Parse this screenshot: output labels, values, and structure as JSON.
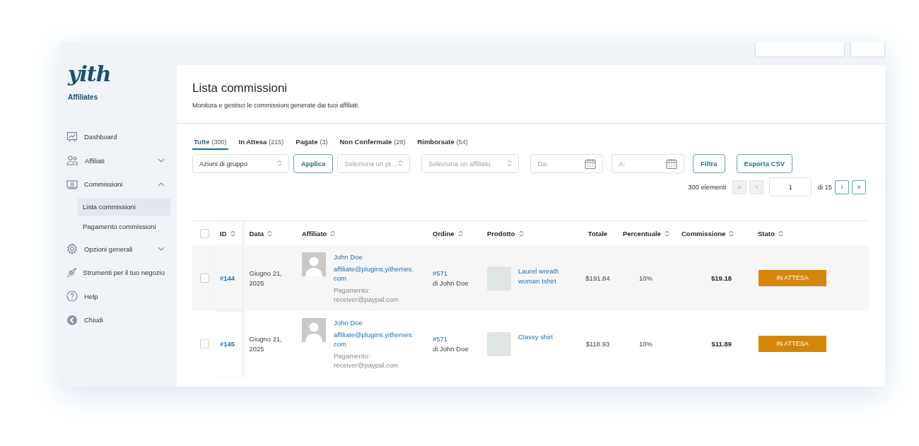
{
  "sidebar": {
    "logo": "yith",
    "product": "Affiliates",
    "items": [
      {
        "label": "Dashboard"
      },
      {
        "label": "Affiliati",
        "expanded": false
      },
      {
        "label": "Commissioni",
        "expanded": true,
        "children": [
          {
            "label": "Lista commissioni",
            "selected": true
          },
          {
            "label": "Pagamento commissioni",
            "selected": false
          }
        ]
      },
      {
        "label": "Opzioni generali",
        "expanded": false
      },
      {
        "label": "Strumenti per il tuo negozio"
      },
      {
        "label": "Help"
      },
      {
        "label": "Chiudi"
      }
    ]
  },
  "header": {
    "title": "Lista commissioni",
    "description": "Monitora e gestisci le commissioni generate dai tuoi affiliati."
  },
  "tabs": [
    {
      "label": "Tutte",
      "count": "(300)",
      "selected": true
    },
    {
      "label": "In Attesa",
      "count": "(215)",
      "selected": false
    },
    {
      "label": "Pagate",
      "count": "(3)",
      "selected": false
    },
    {
      "label": "Non Confermate",
      "count": "(28)",
      "selected": false
    },
    {
      "label": "Rimborsate",
      "count": "(54)",
      "selected": false
    }
  ],
  "filters": {
    "bulk_actions": {
      "value": "Azioni di gruppo"
    },
    "apply_button": "Applica",
    "product_select": {
      "placeholder": "Seleziona un pr..."
    },
    "affiliate_select": {
      "placeholder": "Seleziona un affiliato"
    },
    "date_from": {
      "placeholder": "Da:"
    },
    "date_to": {
      "placeholder": "A:"
    },
    "filter_button": "Filtra",
    "export_button": "Esporta CSV"
  },
  "pagination": {
    "total": "300 elementi",
    "first": {
      "label": "«",
      "disabled": true
    },
    "prev": {
      "label": "‹",
      "disabled": true
    },
    "page": "1",
    "of": "di 15",
    "next": {
      "label": "›",
      "disabled": false
    },
    "last": {
      "label": "»",
      "disabled": false
    }
  },
  "table": {
    "select_all": {
      "checked": false
    },
    "columns": [
      {
        "label": "ID",
        "sortable": true
      },
      {
        "label": "Data",
        "sortable": true
      },
      {
        "label": "Affiliato",
        "sortable": true
      },
      {
        "label": "Ordine",
        "sortable": true
      },
      {
        "label": "Prodotto",
        "sortable": true
      },
      {
        "label": "Totale",
        "sortable": false
      },
      {
        "label": "Percentuale",
        "sortable": true
      },
      {
        "label": "Commissione",
        "sortable": true
      },
      {
        "label": "Stato",
        "sortable": true
      }
    ],
    "rows": [
      {
        "checked": false,
        "id": "#144",
        "date": "Giugno 21, 2025",
        "affiliate": {
          "name": "John Doe",
          "email": "affiliate@plugins.yithemes.com",
          "payment": "Pagamento: receiver@paypal.com"
        },
        "order": {
          "number": "#571",
          "customer": "di John Doe"
        },
        "product": "Laurel wreath woman tshirt",
        "total": "$191.84",
        "percentage": "10%",
        "commission": "$19.18",
        "status": {
          "label": "IN ATTESA",
          "color": "#d4860b"
        }
      },
      {
        "checked": false,
        "id": "#145",
        "date": "Giugno 21, 2025",
        "affiliate": {
          "name": "John Doe",
          "email": "affiliate@plugins.yithemes.com",
          "payment": "Pagamento: receiver@paypal.com"
        },
        "order": {
          "number": "#571",
          "customer": "di John Doe"
        },
        "product": "Classy shirt",
        "total": "$118.93",
        "percentage": "10%",
        "commission": "$11.89",
        "status": {
          "label": "IN ATTESA",
          "color": "#d4860b"
        }
      }
    ]
  }
}
